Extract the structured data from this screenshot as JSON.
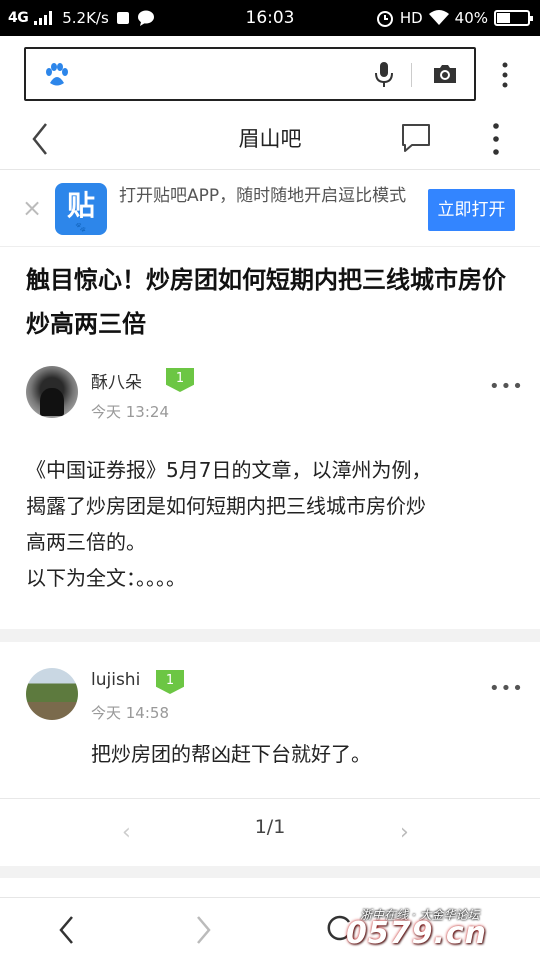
{
  "status_bar": {
    "signal": "4G",
    "speed": "5.2K/s",
    "time": "16:03",
    "hd": "HD",
    "battery": "40%",
    "battery_level": 0.4
  },
  "search_bar": {
    "placeholder": "",
    "icons": [
      "baidu-paw-icon",
      "mic-icon",
      "camera-icon",
      "more-vertical-icon"
    ]
  },
  "header": {
    "title": "眉山吧"
  },
  "app_banner": {
    "logo_text": "贴",
    "text": "打开贴吧APP，随时随地开启逗比模式",
    "button": "立即打开",
    "accent": "#3385ff"
  },
  "post": {
    "title": "触目惊心！炒房团如何短期内把三线城市房价炒高两三倍",
    "author": "酥八朵",
    "level": "1",
    "time": "今天 13:24",
    "body_lines": [
      "《中国证券报》5月7日的文章，以漳州为例，",
      "揭露了炒房团是如何短期内把三线城市房价炒",
      "高两三倍的。",
      "以下为全文：。。。。"
    ]
  },
  "reply": {
    "author": "lujishi",
    "level": "1",
    "time": "今天 14:58",
    "text": "把炒房团的帮凶赶下台就好了。"
  },
  "pager": {
    "text": "1/1",
    "prev": "‹",
    "next": "›"
  },
  "watermark": {
    "top": "浙中在线 · 大金华论坛",
    "big": "0579.cn"
  },
  "colors": {
    "level_badge": "#6cc644",
    "separator": "#f2f2f2"
  }
}
